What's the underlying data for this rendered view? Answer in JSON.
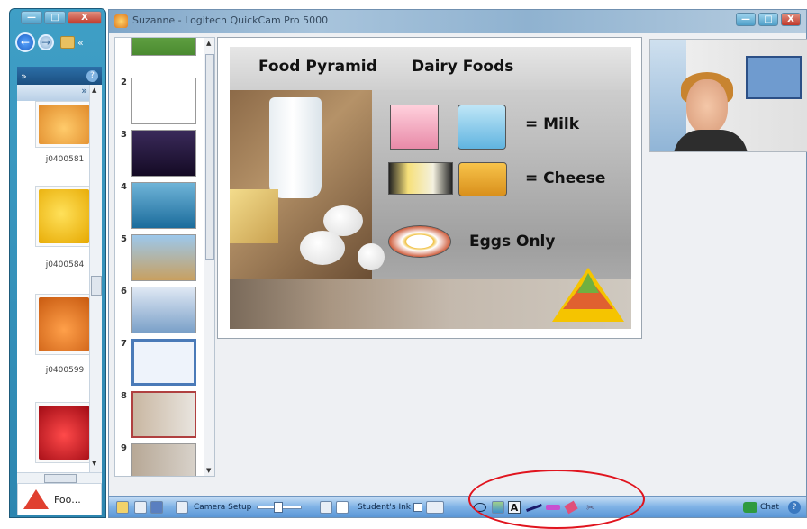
{
  "explorer": {
    "pane_chevron": "»",
    "list_chevron": "»",
    "help": "?",
    "back_chevron": "«",
    "items": [
      {
        "label": "j0400581",
        "color": "#f0a050"
      },
      {
        "label": "j0400584",
        "color": "#f6c70a"
      },
      {
        "label": "j0400599",
        "color": "#ff8a1f"
      },
      {
        "label": "",
        "color": "#e0242a"
      }
    ],
    "task_label": "Foo..."
  },
  "window": {
    "title": "Suzanne - Logitech QuickCam Pro 5000"
  },
  "slides": [
    {
      "num": "2"
    },
    {
      "num": "3"
    },
    {
      "num": "4"
    },
    {
      "num": "5"
    },
    {
      "num": "6"
    },
    {
      "num": "7"
    },
    {
      "num": "8"
    },
    {
      "num": "9"
    }
  ],
  "slide": {
    "title_left": "Food Pyramid",
    "title_right": "Dairy Foods",
    "milk_label": "= Milk",
    "cheese_label": "= Cheese",
    "eggs_label": "Eggs Only"
  },
  "toolbar": {
    "camera_setup": "Camera Setup",
    "students_ink": "Student's Ink",
    "chat": "Chat",
    "font_a": "A",
    "help": "?"
  },
  "colors": {
    "annotation": "#e0141e",
    "toolbar": "#7fb2e6"
  }
}
